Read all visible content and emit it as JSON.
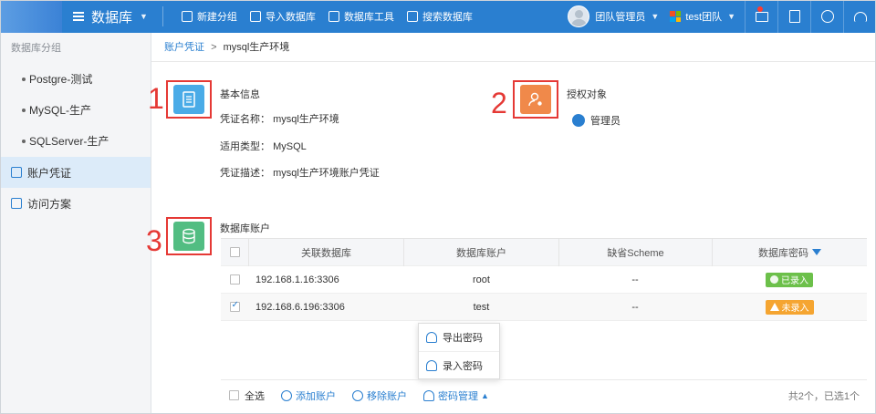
{
  "topbar": {
    "app_title": "数据库",
    "actions": [
      {
        "label": "新建分组",
        "icon": "folder-plus-icon"
      },
      {
        "label": "导入数据库",
        "icon": "import-icon"
      },
      {
        "label": "数据库工具",
        "icon": "database-icon"
      },
      {
        "label": "搜索数据库",
        "icon": "search-database-icon"
      }
    ],
    "user_name": "团队管理员",
    "team_name": "test团队"
  },
  "sidebar": {
    "header": "数据库分组",
    "groups": [
      {
        "label": "Postgre-测试"
      },
      {
        "label": "MySQL-生产"
      },
      {
        "label": "SQLServer-生产"
      }
    ],
    "items": [
      {
        "label": "账户凭证",
        "active": true
      },
      {
        "label": "访问方案",
        "active": false
      }
    ]
  },
  "breadcrumb": {
    "parent": "账户凭证",
    "separator": ">",
    "current": "mysql生产环境"
  },
  "markers": {
    "one": "1",
    "two": "2",
    "three": "3"
  },
  "basic_info": {
    "title": "基本信息",
    "name_label": "凭证名称：",
    "name_value": "mysql生产环境",
    "type_label": "适用类型：",
    "type_value": "MySQL",
    "desc_label": "凭证描述：",
    "desc_value": "mysql生产环境账户凭证"
  },
  "authorization": {
    "title": "授权对象",
    "user": "管理员"
  },
  "db_accounts": {
    "title": "数据库账户",
    "columns": [
      "关联数据库",
      "数据库账户",
      "缺省Scheme",
      "数据库密码"
    ],
    "rows": [
      {
        "db": "192.168.1.16:3306",
        "account": "root",
        "schema": "--",
        "status": "已录入",
        "checked": false
      },
      {
        "db": "192.168.6.196:3306",
        "account": "test",
        "schema": "--",
        "status": "未录入",
        "checked": true
      }
    ]
  },
  "dropdown": {
    "items": [
      "导出密码",
      "录入密码"
    ]
  },
  "footer": {
    "select_all": "全选",
    "add": "添加账户",
    "remove": "移除账户",
    "password_mgmt": "密码管理",
    "count": "共2个，已选1个"
  },
  "colors": {
    "primary": "#2a7fd0",
    "ok": "#6cc04a",
    "warn": "#f5a531",
    "marker": "#e53935"
  }
}
